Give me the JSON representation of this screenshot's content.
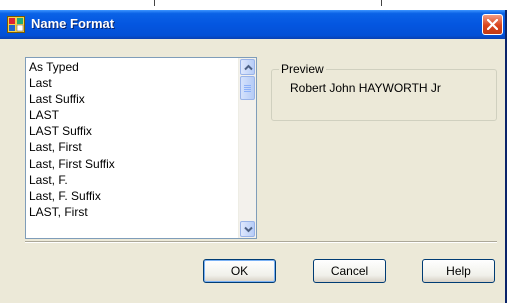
{
  "window": {
    "title": "Name Format"
  },
  "list": {
    "items": [
      "As Typed",
      "Last",
      "Last Suffix",
      "LAST",
      "LAST Suffix",
      "Last, First",
      "Last, First Suffix",
      "Last, F.",
      "Last, F. Suffix",
      "LAST, First"
    ]
  },
  "preview": {
    "label": "Preview",
    "value": "Robert John HAYWORTH Jr"
  },
  "buttons": {
    "ok": "OK",
    "cancel": "Cancel",
    "help": "Help"
  },
  "colors": {
    "titlebar": "#0456e0",
    "dialog_bg": "#ece9d8",
    "close_button": "#d9441c"
  },
  "icons": {
    "app": "name-card-icon",
    "close": "close-icon",
    "scroll_up": "chevron-up-icon",
    "scroll_down": "chevron-down-icon"
  }
}
